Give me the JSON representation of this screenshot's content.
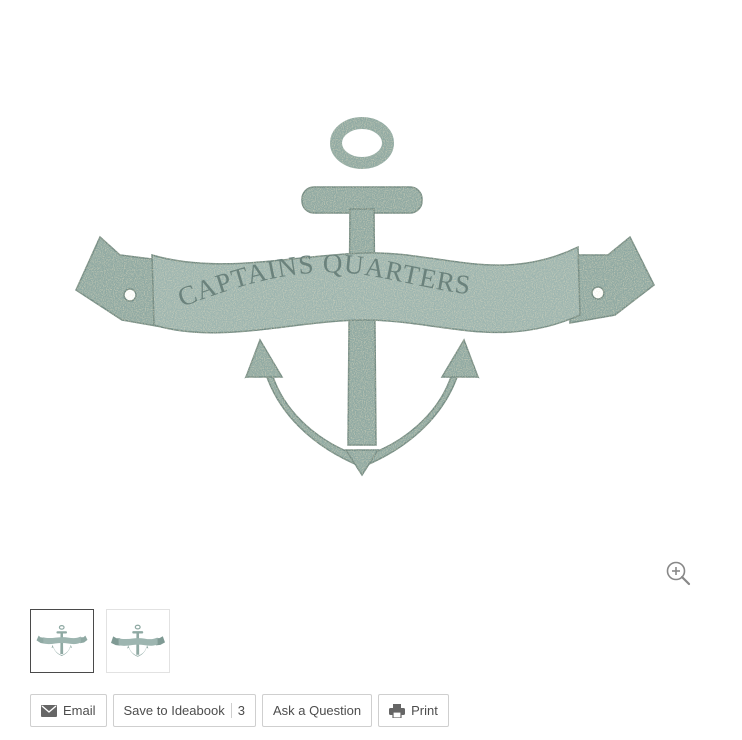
{
  "product": {
    "banner_text": "CAPTAINS QUARTERS"
  },
  "gallery": {
    "zoom_icon": "zoom-in-icon",
    "thumbnails": [
      {
        "active": true
      },
      {
        "active": false
      }
    ]
  },
  "actions": {
    "email_label": "Email",
    "save_label": "Save to Ideabook",
    "save_count": "3",
    "ask_label": "Ask a Question",
    "print_label": "Print"
  },
  "colors": {
    "metal": "#8fa9a3",
    "metal_dark": "#6f8983",
    "metal_light": "#b7ccc7",
    "border": "#cfcfcf"
  }
}
